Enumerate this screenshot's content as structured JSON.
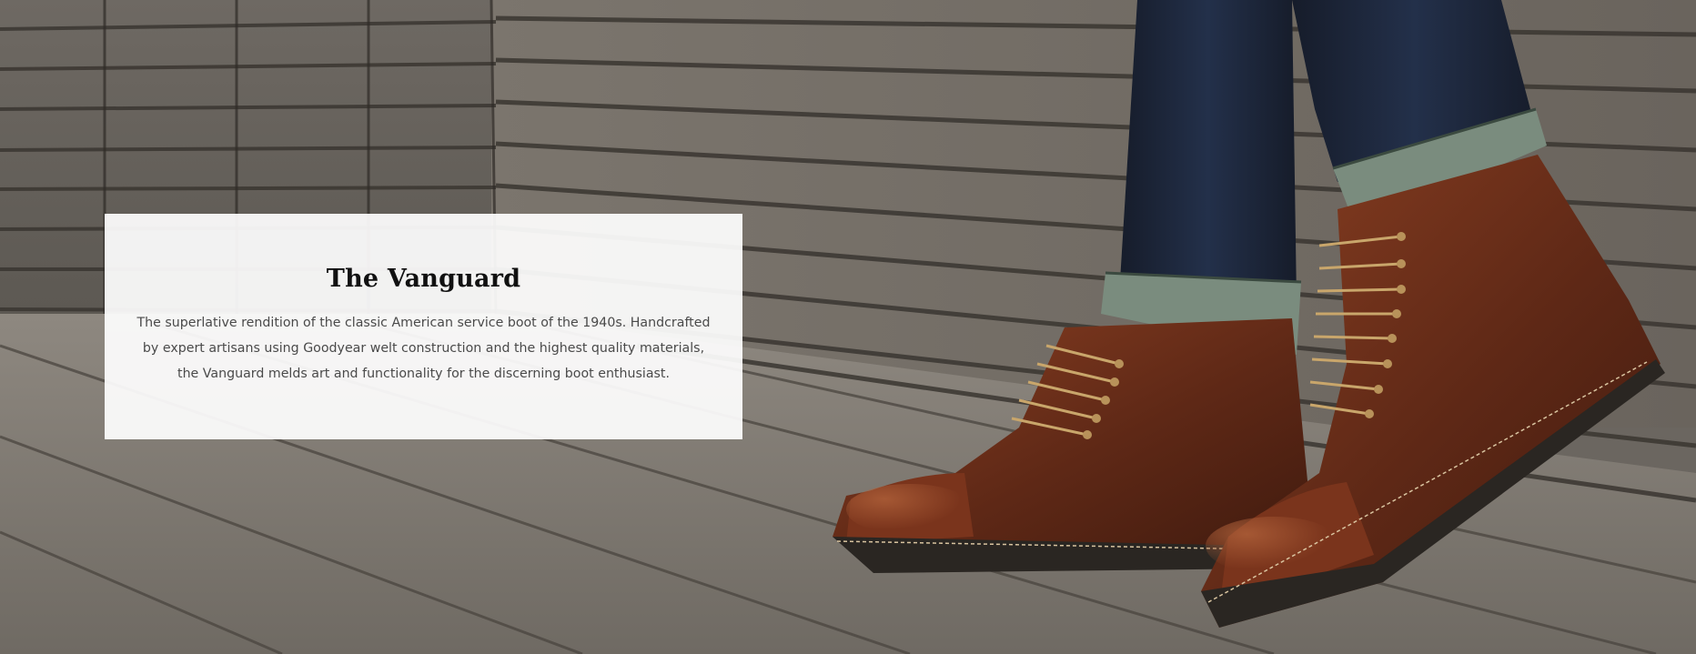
{
  "hero": {
    "image_alt": "Brown leather cap-toe lace-up boots worn with cuffed dark denim on a weathered wooden deck",
    "colors": {
      "wood_light": "#8a847c",
      "wood_dark": "#3a3631",
      "denim": "#1c2333",
      "denim_cuff": "#7a8c7e",
      "leather": "#6b2f1a",
      "leather_highlight": "#9a4a2a",
      "sole": "#2a2622",
      "card_bg": "#ffffff"
    }
  },
  "card": {
    "title": "The Vanguard",
    "description": "The superlative rendition of the classic American service boot of the 1940s. Handcrafted by expert artisans using Goodyear welt construction and the highest quality materials, the Vanguard melds art and functionality for the discerning boot enthusiast."
  }
}
